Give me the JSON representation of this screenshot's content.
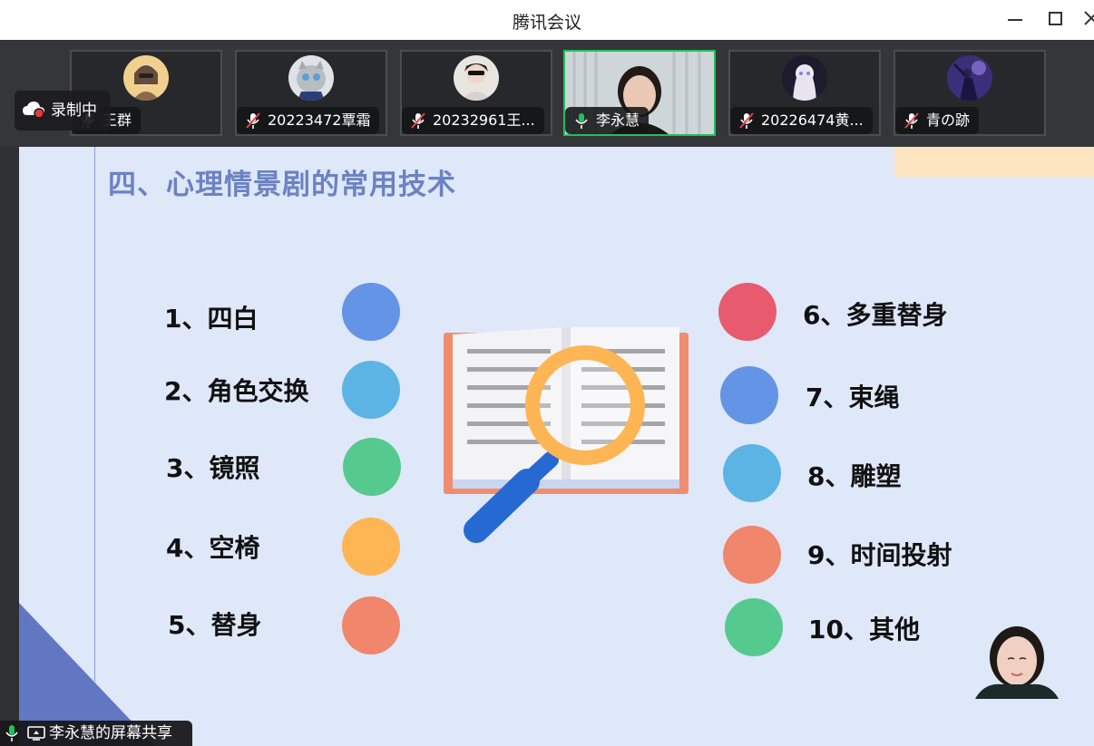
{
  "window": {
    "title": "腾讯会议"
  },
  "recording": {
    "label": "录制中"
  },
  "participants": [
    {
      "name": "王群",
      "muted": true,
      "active": false
    },
    {
      "name": "20223472覃霜",
      "muted": true,
      "active": false
    },
    {
      "name": "20232961王...",
      "muted": true,
      "active": false
    },
    {
      "name": "李永慧",
      "muted": false,
      "active": true
    },
    {
      "name": "20226474黄...",
      "muted": true,
      "active": false
    },
    {
      "name": "青の跡",
      "muted": true,
      "active": false
    }
  ],
  "slide": {
    "title": "四、心理情景剧的常用技术",
    "left_items": [
      "1、四白",
      "2、角色交换",
      "3、镜照",
      "4、空椅",
      "5、替身"
    ],
    "right_items": [
      "6、多重替身",
      "7、束绳",
      "8、雕塑",
      "9、时间投射",
      "10、其他"
    ],
    "left_dot_colors": [
      "#6494e6",
      "#5cb4e4",
      "#56c98f",
      "#feb553",
      "#f0866c"
    ],
    "right_dot_colors": [
      "#e85b6e",
      "#6494e6",
      "#5cb4e4",
      "#f0866c",
      "#56c98f"
    ]
  },
  "share": {
    "label": "李永慧的屏幕共享"
  },
  "colors": {
    "active_border": "#21c05c",
    "mic_on": "#21c05c",
    "mic_off": "#e0444a"
  }
}
